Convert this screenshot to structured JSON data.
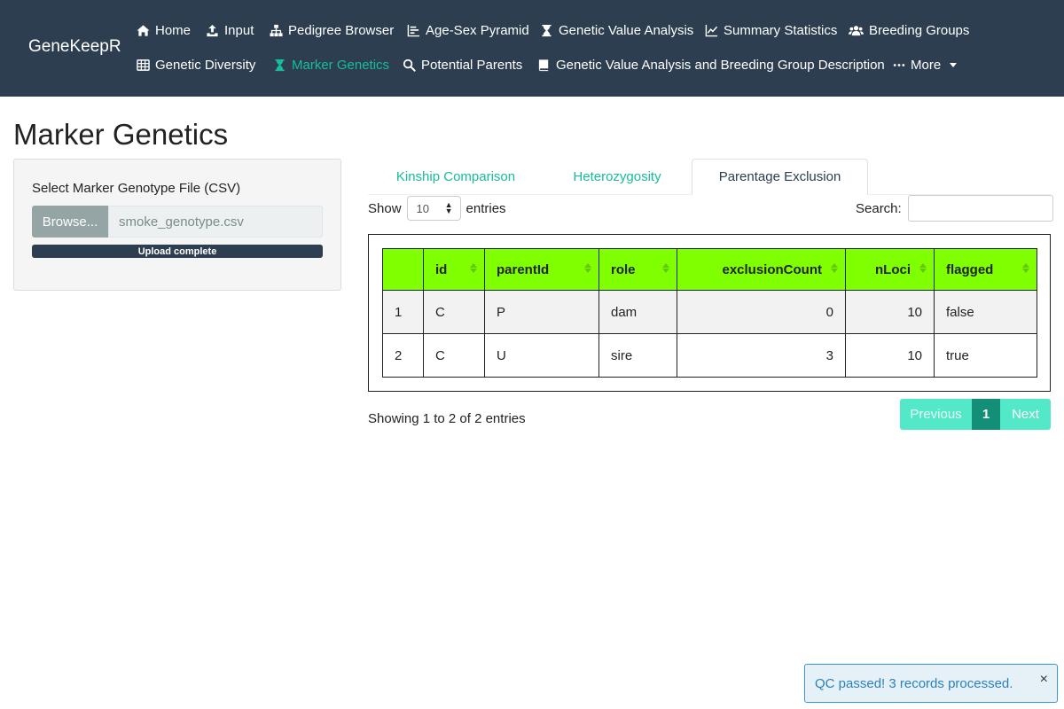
{
  "app": {
    "brand": "GeneKeepR"
  },
  "nav": {
    "row1": [
      {
        "label": "Home",
        "icon": "home-icon"
      },
      {
        "label": "Input",
        "icon": "upload-icon"
      },
      {
        "label": "Pedigree Browser",
        "icon": "sitemap-icon"
      },
      {
        "label": "Age-Sex Pyramid",
        "icon": "bar-chart-icon"
      },
      {
        "label": "Genetic Value Analysis",
        "icon": "hourglass-icon"
      },
      {
        "label": "Summary Statistics",
        "icon": "line-chart-icon"
      },
      {
        "label": "Breeding Groups",
        "icon": "users-icon"
      }
    ],
    "row2": [
      {
        "label": "Genetic Diversity",
        "icon": "table-icon"
      },
      {
        "label": "Marker Genetics",
        "icon": "hourglass-icon",
        "active": true
      },
      {
        "label": "Potential Parents",
        "icon": "search-icon"
      },
      {
        "label": "Genetic Value Analysis and Breeding Group Description",
        "icon": "book-icon"
      },
      {
        "label": "More",
        "icon": "ellipsis-icon"
      }
    ]
  },
  "page": {
    "title": "Marker Genetics"
  },
  "sidebar": {
    "file_label": "Select Marker Genotype File (CSV)",
    "browse_label": "Browse...",
    "file_name": "smoke_genotype.csv",
    "progress_label": "Upload complete",
    "progress_value": 100
  },
  "tabs": [
    {
      "label": "Kinship Comparison",
      "active": false
    },
    {
      "label": "Heterozygosity",
      "active": false
    },
    {
      "label": "Parentage Exclusion",
      "active": true
    }
  ],
  "table_controls": {
    "show_label": "Show",
    "page_length": "10",
    "entries_label": "entries",
    "search_label": "Search:",
    "search_value": ""
  },
  "table": {
    "columns": [
      "",
      "id",
      "parentId",
      "role",
      "exclusionCount",
      "nLoci",
      "flagged"
    ],
    "rows": [
      [
        "1",
        "C",
        "P",
        "dam",
        "0",
        "10",
        "false"
      ],
      [
        "2",
        "C",
        "U",
        "sire",
        "3",
        "10",
        "true"
      ]
    ]
  },
  "table_footer": {
    "info": "Showing 1 to 2 of 2 entries",
    "previous": "Previous",
    "current_page": "1",
    "next": "Next"
  },
  "notification": {
    "message": "QC passed! 3 records processed.",
    "close": "×"
  },
  "colors": {
    "navbar": "#2c3e50",
    "accent": "#18bc9c",
    "table_header": "#7fff00",
    "info_border": "#3498db"
  }
}
